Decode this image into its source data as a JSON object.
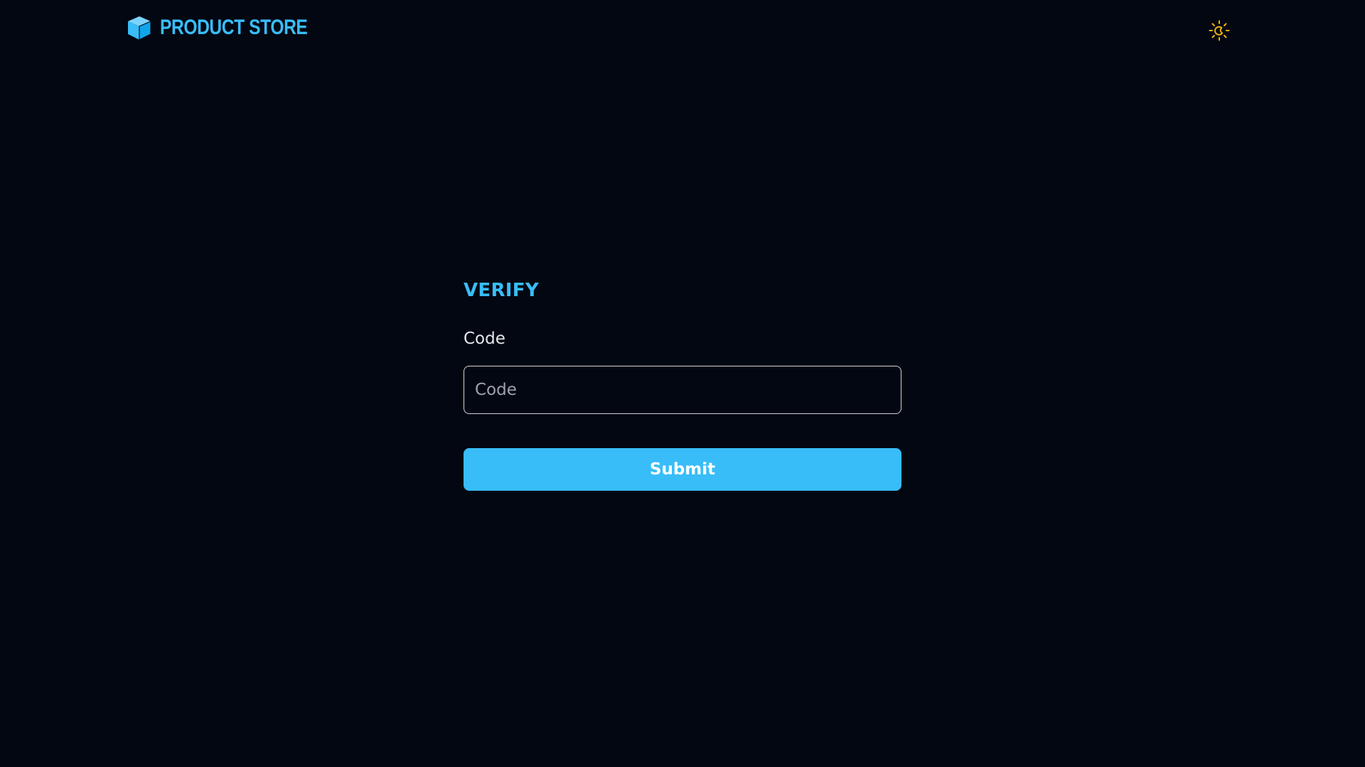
{
  "app": {
    "brand_name": "PRODUCT STORE",
    "accent_color": "#38bdf8",
    "background_color": "#030712"
  },
  "header": {
    "logo_icon": "cube-icon",
    "theme_toggle_icon": "sun-moon-icon",
    "theme_toggle_color": "#eab308"
  },
  "form": {
    "title": "VERIFY",
    "code_label": "Code",
    "code_placeholder": "Code",
    "code_value": "",
    "submit_label": "Submit"
  }
}
